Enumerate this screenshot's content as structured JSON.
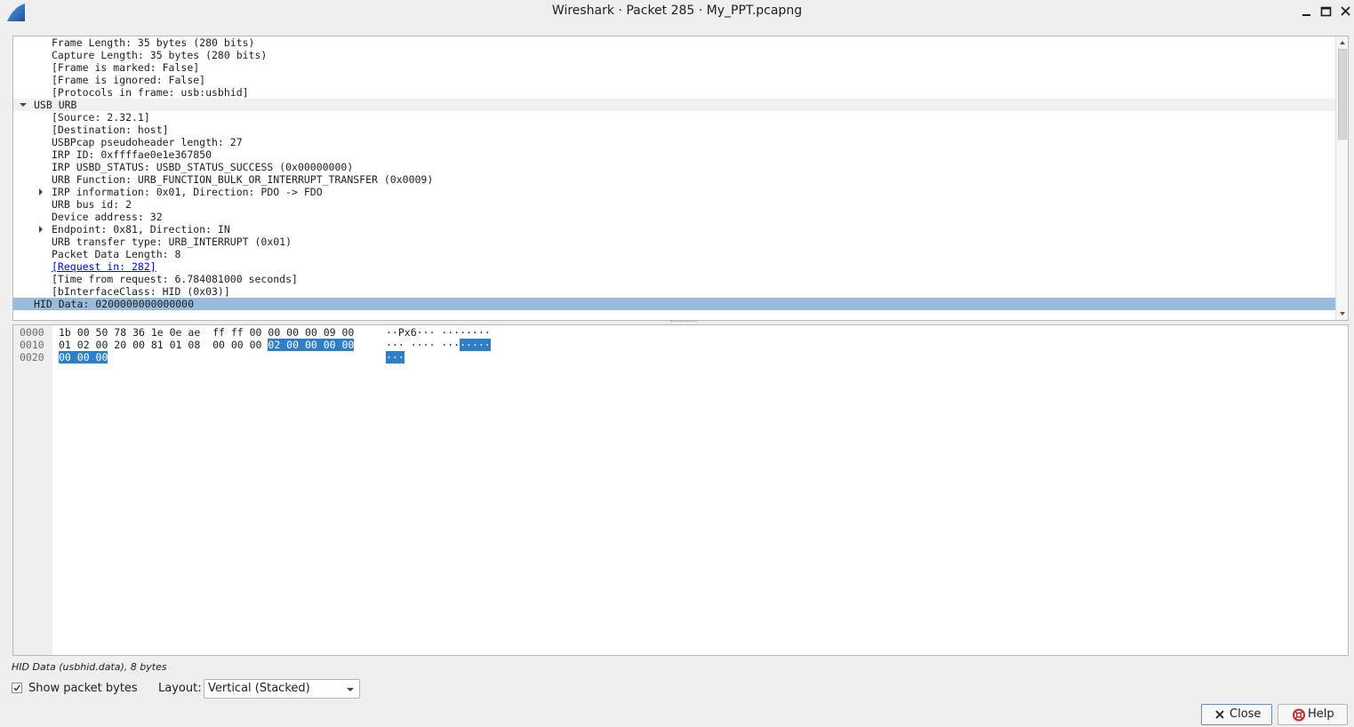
{
  "window": {
    "title": "Wireshark · Packet 285 · My_PPT.pcapng",
    "icons": {
      "app": "wireshark-fin-icon",
      "minimize": "minimize-icon",
      "maximize": "maximize-icon",
      "close": "close-icon"
    }
  },
  "tree": {
    "rows": [
      {
        "level": 1,
        "text": "Frame Length: 35 bytes (280 bits)",
        "expander": "none"
      },
      {
        "level": 1,
        "text": "Capture Length: 35 bytes (280 bits)",
        "expander": "none"
      },
      {
        "level": 1,
        "text": "[Frame is marked: False]",
        "expander": "none"
      },
      {
        "level": 1,
        "text": "[Frame is ignored: False]",
        "expander": "none"
      },
      {
        "level": 1,
        "text": "[Protocols in frame: usb:usbhid]",
        "expander": "none"
      },
      {
        "level": 0,
        "text": "USB URB",
        "expander": "expanded",
        "alt": true
      },
      {
        "level": 1,
        "text": "[Source: 2.32.1]",
        "expander": "none"
      },
      {
        "level": 1,
        "text": "[Destination: host]",
        "expander": "none"
      },
      {
        "level": 1,
        "text": "USBPcap pseudoheader length: 27",
        "expander": "none"
      },
      {
        "level": 1,
        "text": "IRP ID: 0xffffae0e1e367850",
        "expander": "none"
      },
      {
        "level": 1,
        "text": "IRP USBD_STATUS: USBD_STATUS_SUCCESS (0x00000000)",
        "expander": "none"
      },
      {
        "level": 1,
        "text": "URB Function: URB_FUNCTION_BULK_OR_INTERRUPT_TRANSFER (0x0009)",
        "expander": "none"
      },
      {
        "level": 1,
        "text": "IRP information: 0x01, Direction: PDO -> FDO",
        "expander": "collapsed"
      },
      {
        "level": 1,
        "text": "URB bus id: 2",
        "expander": "none"
      },
      {
        "level": 1,
        "text": "Device address: 32",
        "expander": "none"
      },
      {
        "level": 1,
        "text": "Endpoint: 0x81, Direction: IN",
        "expander": "collapsed"
      },
      {
        "level": 1,
        "text": "URB transfer type: URB_INTERRUPT (0x01)",
        "expander": "none"
      },
      {
        "level": 1,
        "text": "Packet Data Length: 8",
        "expander": "none"
      },
      {
        "level": 1,
        "text": "[Request in: 282]",
        "expander": "none",
        "link": true
      },
      {
        "level": 1,
        "text": "[Time from request: 6.784081000 seconds]",
        "expander": "none"
      },
      {
        "level": 1,
        "text": "[bInterfaceClass: HID (0x03)]",
        "expander": "none"
      },
      {
        "level": 0,
        "text": "HID Data: 0200000000000000",
        "expander": "none",
        "selected": true
      }
    ],
    "icons": {
      "expanded": "expanded-arrow-icon",
      "collapsed": "collapsed-arrow-icon"
    }
  },
  "bytes": {
    "rows": [
      {
        "offset": "0000",
        "hex_plain": "1b 00 50 78 36 1e 0e ae  ff ff 00 00 00 00 09 00",
        "hex_hl": "",
        "ascii_plain": "··Px6··· ········",
        "ascii_hl": ""
      },
      {
        "offset": "0010",
        "hex_plain": "01 02 00 20 00 81 01 08  00 00 00 ",
        "hex_hl": "02 00 00 00 00",
        "ascii_plain": "··· ···· ···",
        "ascii_hl": "·····"
      },
      {
        "offset": "0020",
        "hex_plain": "",
        "hex_hl": "00 00 00",
        "ascii_plain": "",
        "ascii_hl": "···"
      }
    ]
  },
  "status": {
    "text": "HID Data (usbhid.data), 8 bytes"
  },
  "footer": {
    "show_bytes_label": "Show packet bytes",
    "show_bytes_checked": true,
    "layout_label": "Layout:",
    "layout_value": "Vertical (Stacked)",
    "close_label": "Close",
    "help_label": "Help"
  },
  "colors": {
    "selection_row": "#98bcd9",
    "byte_highlight": "#2f7fc8",
    "link": "#0000ee"
  }
}
